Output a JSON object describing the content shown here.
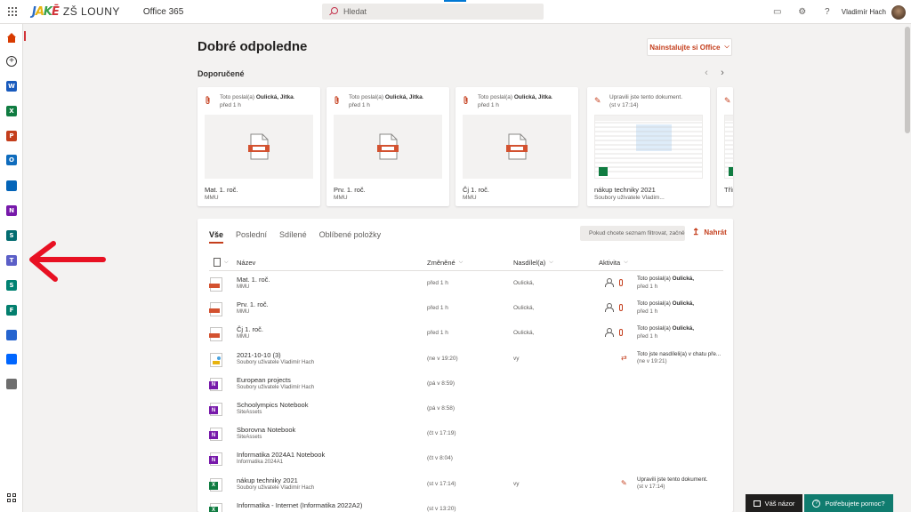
{
  "topbar": {
    "logo_letters": [
      "J",
      "A",
      "K",
      "Ē"
    ],
    "school": "ZŠ LOUNY",
    "office_link": "Office 365",
    "search_placeholder": "Hledat",
    "user_name": "Vladimír Hach"
  },
  "main": {
    "greeting": "Dobré odpoledne",
    "install_button": "Nainstalujte si Office",
    "recommended_label": "Doporučené"
  },
  "recommended": [
    {
      "line1_prefix": "Toto poslal(a) ",
      "line1_name": "Oulická, Jitka",
      "line1_suffix": ".",
      "line2": "před 1 h",
      "title": "Mat. 1. roč.",
      "location": "MMU",
      "kind": "doc"
    },
    {
      "line1_prefix": "Toto poslal(a) ",
      "line1_name": "Oulická, Jitka",
      "line1_suffix": ".",
      "line2": "před 1 h",
      "title": "Prv. 1. roč.",
      "location": "MMU",
      "kind": "doc"
    },
    {
      "line1_prefix": "Toto poslal(a) ",
      "line1_name": "Oulická, Jitka",
      "line1_suffix": ".",
      "line2": "před 1 h",
      "title": "Čj 1. roč.",
      "location": "MMU",
      "kind": "doc"
    },
    {
      "line1_prefix": "Upravili jste tento dokument.",
      "line1_name": "",
      "line1_suffix": "",
      "line2": "(st v 17:14)",
      "title": "nákup techniky 2021",
      "location": "Soubory uživatele Vladim...",
      "kind": "sheet"
    },
    {
      "line1_prefix": "",
      "line1_name": "",
      "line1_suffix": "",
      "line2": "",
      "title": "Třír",
      "location": "",
      "kind": "sheet"
    }
  ],
  "files": {
    "tabs": [
      "Vše",
      "Poslední",
      "Sdílené",
      "Oblíbené položky"
    ],
    "filter_placeholder": "Pokud chcete seznam filtrovat, začně",
    "upload_label": "Nahrát",
    "columns": {
      "name": "Název",
      "modified": "Změněné",
      "shared_by": "Nasdílel(a)",
      "activity": "Aktivita"
    },
    "rows": [
      {
        "name": "Mat. 1. roč.",
        "location": "MMU",
        "modified": "před 1 h",
        "shared": "Oulická,",
        "act1_prefix": "Toto poslal(a) ",
        "act1_bold": "Oulická,",
        "act2": "před 1 h",
        "type": "doc",
        "act": "sent"
      },
      {
        "name": "Prv. 1. roč.",
        "location": "MMU",
        "modified": "před 1 h",
        "shared": "Oulická,",
        "act1_prefix": "Toto poslal(a) ",
        "act1_bold": "Oulická,",
        "act2": "před 1 h",
        "type": "doc",
        "act": "sent"
      },
      {
        "name": "Čj 1. roč.",
        "location": "MMU",
        "modified": "před 1 h",
        "shared": "Oulická,",
        "act1_prefix": "Toto poslal(a) ",
        "act1_bold": "Oulická,",
        "act2": "před 1 h",
        "type": "doc",
        "act": "sent"
      },
      {
        "name": "2021-10-10 (3)",
        "location": "Soubory uživatele Vladimír Hach",
        "modified": "(ne v 19:20)",
        "shared": "vy",
        "act1_prefix": "Toto jste nasdíleli(a) v chatu pře...",
        "act1_bold": "",
        "act2": "(ne v 19:21)",
        "type": "img",
        "act": "shared"
      },
      {
        "name": "European projects",
        "location": "Soubory uživatele Vladimír Hach",
        "modified": "(pá v 8:59)",
        "shared": "",
        "act1_prefix": "",
        "act1_bold": "",
        "act2": "",
        "type": "one",
        "act": "none"
      },
      {
        "name": "Schoolympics Notebook",
        "location": "SiteAssets",
        "modified": "(pá v 8:58)",
        "shared": "",
        "act1_prefix": "",
        "act1_bold": "",
        "act2": "",
        "type": "one",
        "act": "none"
      },
      {
        "name": "Sborovna Notebook",
        "location": "SiteAssets",
        "modified": "(čt v 17:19)",
        "shared": "",
        "act1_prefix": "",
        "act1_bold": "",
        "act2": "",
        "type": "one",
        "act": "none"
      },
      {
        "name": "Informatika 2024A1 Notebook",
        "location": "Informatika 2024A1",
        "modified": "(čt v 8:04)",
        "shared": "",
        "act1_prefix": "",
        "act1_bold": "",
        "act2": "",
        "type": "one",
        "act": "none"
      },
      {
        "name": "nákup techniky 2021",
        "location": "Soubory uživatele Vladimír Hach",
        "modified": "(st v 17:14)",
        "shared": "vy",
        "act1_prefix": "Upravili jste tento dokument.",
        "act1_bold": "",
        "act2": "(st v 17:14)",
        "type": "xls",
        "act": "edited"
      },
      {
        "name": "Informatika - Internet (Informatika 2022A2)",
        "location": "",
        "modified": "(st v 13:20)",
        "shared": "",
        "act1_prefix": "",
        "act1_bold": "",
        "act2": "",
        "type": "xls",
        "act": "none"
      }
    ]
  },
  "rail_apps": [
    {
      "name": "word",
      "letter": "W",
      "color": "#185abd"
    },
    {
      "name": "excel",
      "letter": "X",
      "color": "#107c41"
    },
    {
      "name": "powerpoint",
      "letter": "P",
      "color": "#c43e1c"
    },
    {
      "name": "outlook",
      "letter": "O",
      "color": "#0f6cbd"
    },
    {
      "name": "onedrive",
      "letter": "",
      "color": "#0364b8"
    },
    {
      "name": "onenote",
      "letter": "N",
      "color": "#7719aa"
    },
    {
      "name": "sharepoint",
      "letter": "S",
      "color": "#036c70"
    },
    {
      "name": "teams",
      "letter": "T",
      "color": "#5b5fc7"
    },
    {
      "name": "sway",
      "letter": "S",
      "color": "#008272"
    },
    {
      "name": "forms",
      "letter": "F",
      "color": "#037f6e"
    },
    {
      "name": "todo",
      "letter": "",
      "color": "#2564cf"
    },
    {
      "name": "power-automate",
      "letter": "",
      "color": "#0066ff"
    },
    {
      "name": "class-notebook",
      "letter": "",
      "color": "#6e6e6e"
    }
  ],
  "bottom": {
    "feedback": "Váš názor",
    "help": "Potřebujete pomoc?"
  },
  "colors": {
    "accent": "#c43e1c",
    "arrow": "#e81123"
  }
}
